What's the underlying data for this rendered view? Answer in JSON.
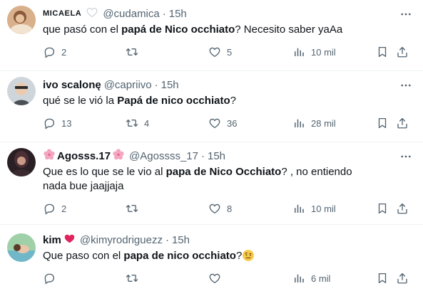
{
  "tweets": [
    {
      "name": "MICAELA",
      "handle": "@cudamica",
      "time": "15h",
      "text_pre": "que pasó con el ",
      "text_bold": "papá de Nico occhiato",
      "text_post": "? Necesito saber yaAa",
      "replies": "2",
      "retweets": "",
      "likes": "5",
      "views": "10 mil"
    },
    {
      "name": "ivo scalonę",
      "handle": "@capriivo",
      "time": "15h",
      "text_pre": "qué se le vió la ",
      "text_bold": "Papá de nico occhiato",
      "text_post": "?",
      "replies": "13",
      "retweets": "4",
      "likes": "36",
      "views": "28 mil"
    },
    {
      "name": "Agosss.17",
      "handle": "@Agossss_17",
      "time": "15h",
      "text_pre": "Que es lo que se le vio al ",
      "text_bold": "papa de Nico Occhiato",
      "text_post": "? , no entiendo nada bue jaajjaja",
      "replies": "2",
      "retweets": "",
      "likes": "8",
      "views": "10 mil"
    },
    {
      "name": "kim",
      "handle": "@kimyrodriguezz",
      "time": "15h",
      "text_pre": "Que paso con el ",
      "text_bold": "papa de nico occhiato",
      "text_post": "?",
      "replies": "",
      "retweets": "",
      "likes": "",
      "views": "6 mil"
    }
  ],
  "separator": "·",
  "icons": {
    "name_decor_1": "white-heart-icon",
    "name_decor_2_left": "cherry-blossom-icon",
    "name_decor_2_right": "cherry-blossom-icon",
    "name_decor_3": "red-heart-icon",
    "text_emoji_3": "face-with-raised-eyebrow-icon",
    "more": "more-icon",
    "reply": "reply-icon",
    "retweet": "retweet-icon",
    "like": "like-icon",
    "views": "views-icon",
    "bookmark": "bookmark-icon",
    "share": "share-icon"
  },
  "colors": {
    "text": "#0f1419",
    "secondary": "#536471",
    "divider": "#eff3f4",
    "heart_red": "#e0245e"
  }
}
